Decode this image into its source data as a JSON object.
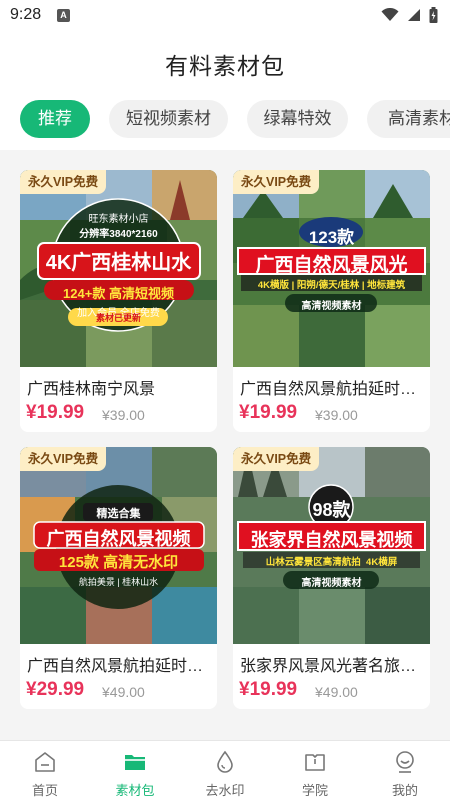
{
  "status": {
    "time": "9:28",
    "app_icon_letter": "A"
  },
  "header": {
    "title": "有料素材包"
  },
  "tabs": [
    {
      "label": "推荐",
      "active": true
    },
    {
      "label": "短视频素材",
      "active": false
    },
    {
      "label": "绿幕特效",
      "active": false
    },
    {
      "label": "高清素材",
      "active": false
    }
  ],
  "cards": [
    {
      "vip": "永久VIP免费",
      "title": "广西桂林南宁风景",
      "price": "¥19.99",
      "original_price": "¥39.00",
      "cover": {
        "shop": "旺东素材小店",
        "resolution": "分辨率3840*2160",
        "headline": "4K广西桂林山水",
        "count_line": "124+款 高清短视频",
        "member": "加入会员 全店免费",
        "update": "素材已更新"
      }
    },
    {
      "vip": "永久VIP免费",
      "title": "广西自然风景航拍延时摄影",
      "price": "¥19.99",
      "original_price": "¥39.00",
      "cover": {
        "count": "123款",
        "headline": "广西自然风景风光",
        "tags": "4K横版 | 阳朔/德天/桂林 | 地标建筑",
        "subtitle": "高清视频素材"
      }
    },
    {
      "vip": "永久VIP免费",
      "title": "广西自然风景航拍延时摄影",
      "price": "¥29.99",
      "original_price": "¥49.00",
      "cover": {
        "collection": "精选合集",
        "headline": "广西自然风景视频",
        "count_line": "125款 高清无水印",
        "tags": "航拍美景 | 桂林山水"
      }
    },
    {
      "vip": "永久VIP免费",
      "title": "张家界风景风光著名旅游景点",
      "price": "¥19.99",
      "original_price": "¥49.00",
      "cover": {
        "count": "98款",
        "headline": "张家界自然风景视频",
        "tags": "山林云雾景区高清航拍  4K横屏",
        "subtitle": "高清视频素材"
      }
    }
  ],
  "nav": [
    {
      "label": "首页",
      "icon": "home-icon",
      "active": false
    },
    {
      "label": "素材包",
      "icon": "folder-icon",
      "active": true
    },
    {
      "label": "去水印",
      "icon": "drop-icon",
      "active": false
    },
    {
      "label": "学院",
      "icon": "book-icon",
      "active": false
    },
    {
      "label": "我的",
      "icon": "profile-icon",
      "active": false
    }
  ],
  "colors": {
    "accent": "#17b877",
    "price": "#e8335a",
    "vip_bg": "#fdeec6",
    "vip_text": "#7a4a14"
  }
}
